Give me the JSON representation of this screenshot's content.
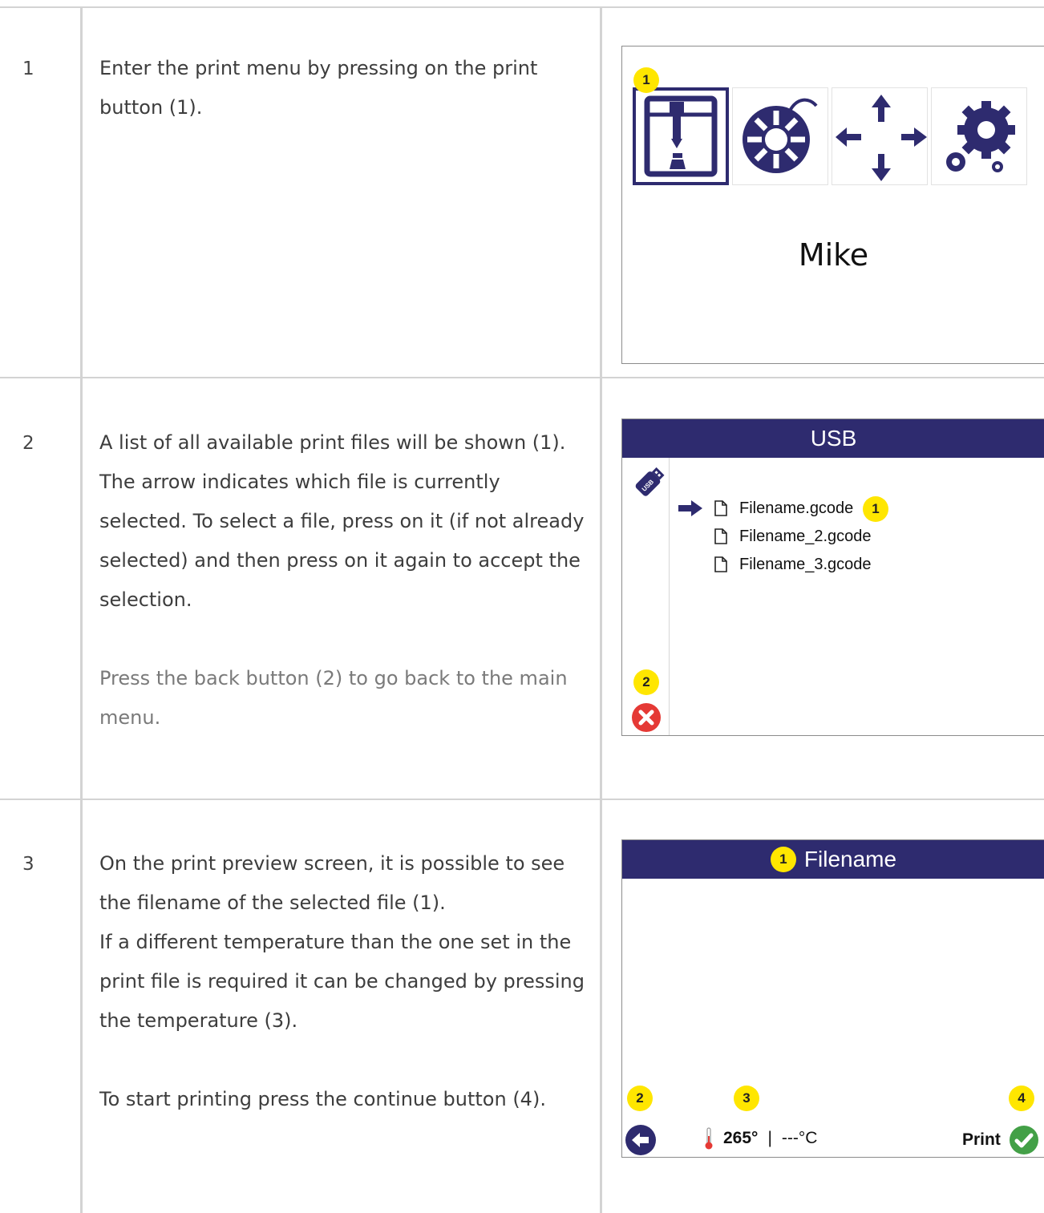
{
  "steps": [
    {
      "number": "1",
      "text": "Enter the print menu by pressing on the print button (1).",
      "screen": {
        "menu_icons": [
          "print-icon",
          "filament-spool-icon",
          "move-arrows-icon",
          "settings-gears-icon"
        ],
        "badge": "1",
        "profile_name": "Mike"
      }
    },
    {
      "number": "2",
      "text": "A list of all available print files will be shown (1). The arrow indicates which file is currently selected. To select a file, press on it (if not already selected) and then press on it again to accept the selection.",
      "note": "Press the back button (2) to go back to the main menu.",
      "screen": {
        "title": "USB",
        "files": [
          "Filename.gcode",
          "Filename_2.gcode",
          "Filename_3.gcode"
        ],
        "selected_index": 0,
        "badge_files": "1",
        "badge_back": "2"
      }
    },
    {
      "number": "3",
      "text1": "On the print preview screen, it is possible to see the filename of the selected file (1).",
      "text2": "If a different temperature than the one set in the print file is required it can be changed by pressing the temperature (3).",
      "text3": "To start printing press the continue button (4).",
      "screen": {
        "title": "Filename",
        "badge_title": "1",
        "badge_back": "2",
        "badge_temp": "3",
        "badge_print": "4",
        "temperature": "265°",
        "separator": "|",
        "temperature_actual": "---°C",
        "print_label": "Print"
      }
    }
  ],
  "colors": {
    "titlebar": "#2e2b6f",
    "badge": "#ffe600",
    "cancel": "#e53935",
    "confirm": "#43a047",
    "grid": "#d3d3d3"
  }
}
